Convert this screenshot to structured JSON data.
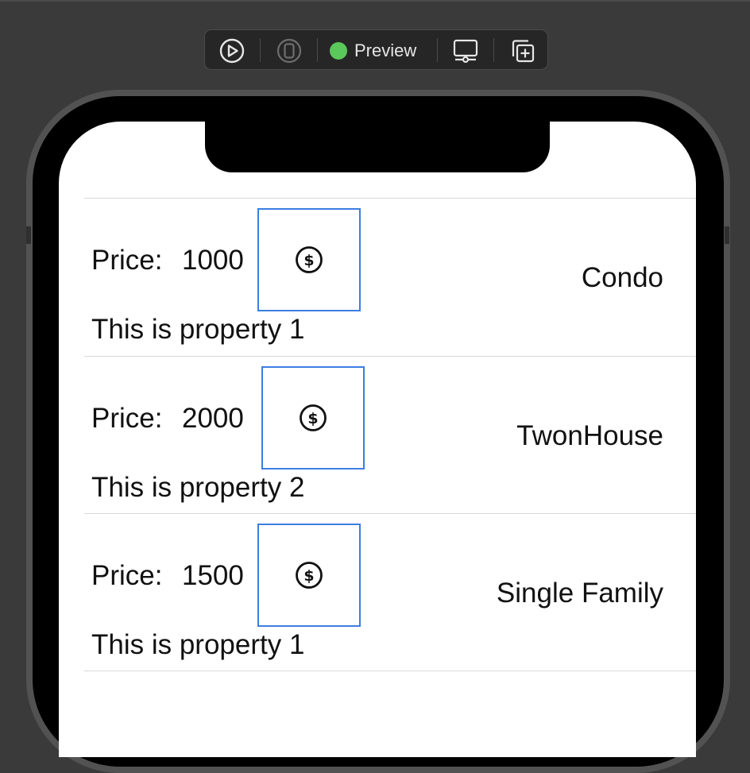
{
  "toolbar": {
    "live_icon": "play-circle-icon",
    "device_icon": "device-select-icon",
    "preview_label": "Preview",
    "status_color": "#5ac85a",
    "device_settings_icon": "device-settings-icon",
    "duplicate_icon": "duplicate-icon"
  },
  "list": {
    "rows": [
      {
        "price_label": "Price:",
        "price": "1000",
        "type": "Condo",
        "description": "This is property 1",
        "icon": "dollar-sign-circle-icon"
      },
      {
        "price_label": "Price:",
        "price": "2000",
        "type": "TwonHouse",
        "description": "This is property 2",
        "icon": "dollar-sign-circle-icon"
      },
      {
        "price_label": "Price:",
        "price": "1500",
        "type": "Single Family",
        "description": "This is property 1",
        "icon": "dollar-sign-circle-icon"
      }
    ]
  },
  "colors": {
    "selection_border": "#3d7ee0",
    "canvas_background": "#3a3a3a"
  }
}
